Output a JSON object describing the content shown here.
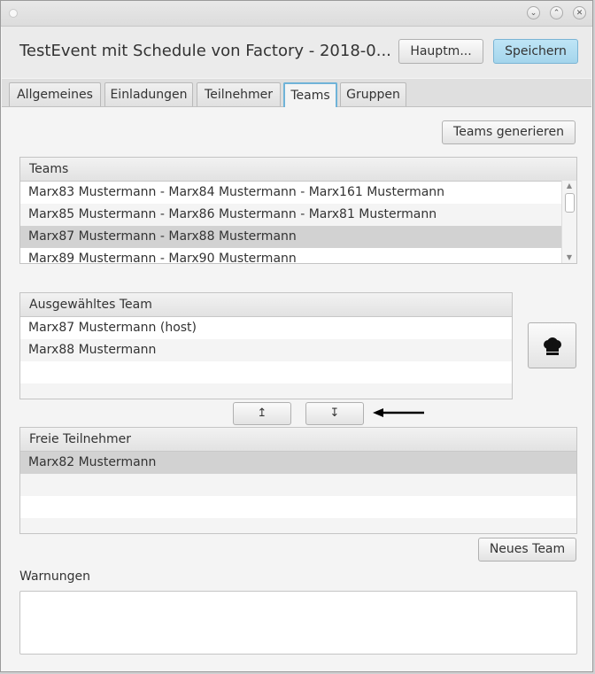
{
  "window": {
    "controls": {
      "minimize": "⌄",
      "maximize": "⌃",
      "close": "✕"
    }
  },
  "header": {
    "title": "TestEvent mit Schedule von Factory - 2018-0...",
    "hauptm_label": "Hauptm...",
    "save_label": "Speichern"
  },
  "tabs": [
    {
      "label": "Allgemeines"
    },
    {
      "label": "Einladungen"
    },
    {
      "label": "Teilnehmer"
    },
    {
      "label": "Teams"
    },
    {
      "label": "Gruppen"
    }
  ],
  "actions": {
    "generate_label": "Teams generieren",
    "new_team_label": "Neues Team",
    "move_up": "↥",
    "move_down": "↧",
    "chef_icon": "chef-hat-icon"
  },
  "teams": {
    "header": "Teams",
    "rows": [
      "Marx83 Mustermann - Marx84 Mustermann - Marx161 Mustermann",
      "Marx85 Mustermann - Marx86 Mustermann - Marx81 Mustermann",
      "Marx87 Mustermann - Marx88 Mustermann",
      "Marx89 Mustermann - Marx90 Mustermann"
    ]
  },
  "selected_team": {
    "header": "Ausgewähltes Team",
    "rows": [
      "Marx87 Mustermann (host)",
      "Marx88 Mustermann"
    ]
  },
  "free": {
    "header": "Freie Teilnehmer",
    "rows": [
      "Marx82 Mustermann"
    ]
  },
  "warnings": {
    "label": "Warnungen"
  }
}
